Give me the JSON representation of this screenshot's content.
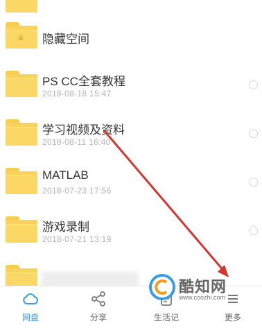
{
  "files": [
    {
      "name": "隐藏空间",
      "date": "",
      "locked": true
    },
    {
      "name": "PS CC全套教程",
      "date": "2018-08-18  15:47"
    },
    {
      "name": "学习视频及资料",
      "date": "2018-08-11  16:40"
    },
    {
      "name": "MATLAB",
      "date": "2018-07-23  17:56"
    },
    {
      "name": "游戏录制",
      "date": "2018-07-21  13:19"
    }
  ],
  "tabs": [
    {
      "label": "网盘",
      "icon": "cloud-icon",
      "active": true
    },
    {
      "label": "分享",
      "icon": "share-icon",
      "active": false
    },
    {
      "label": "生活记",
      "icon": "life-note-icon",
      "active": false
    },
    {
      "label": "更多",
      "icon": "more-icon",
      "active": false
    }
  ],
  "watermark": {
    "brand": "酷知网",
    "url": "www.coozhi.com"
  },
  "colors": {
    "accent": "#3a9be8",
    "folder": "#f9d25d",
    "arrow": "#d9332f"
  }
}
